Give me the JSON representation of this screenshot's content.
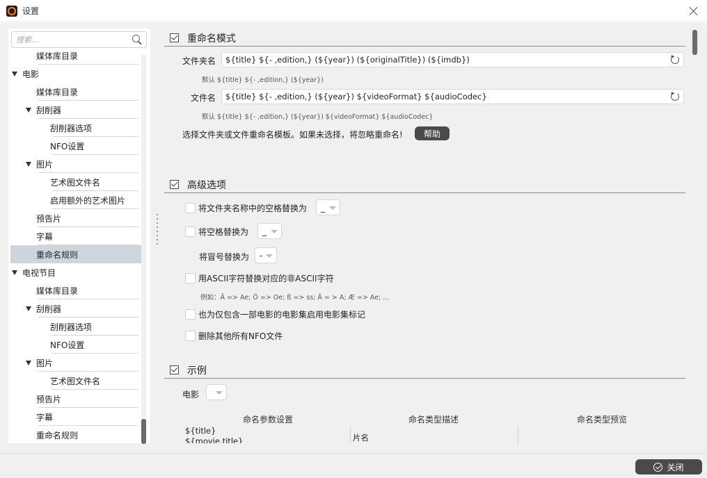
{
  "window": {
    "title": "设置"
  },
  "sidebar": {
    "search_placeholder": "搜索...",
    "items": [
      {
        "label": "媒体库目录",
        "level": 1,
        "expander": false
      },
      {
        "label": "电影",
        "level": 0,
        "expander": true
      },
      {
        "label": "媒体库目录",
        "level": 1,
        "expander": false
      },
      {
        "label": "刮削器",
        "level": 1,
        "expander": true
      },
      {
        "label": "刮削器选项",
        "level": 2,
        "expander": false
      },
      {
        "label": "NFO设置",
        "level": 2,
        "expander": false
      },
      {
        "label": "图片",
        "level": 1,
        "expander": true
      },
      {
        "label": "艺术图文件名",
        "level": 2,
        "expander": false
      },
      {
        "label": "启用额外的艺术图片",
        "level": 2,
        "expander": false
      },
      {
        "label": "预告片",
        "level": 1,
        "expander": false
      },
      {
        "label": "字幕",
        "level": 1,
        "expander": false
      },
      {
        "label": "重命名规则",
        "level": 1,
        "expander": false,
        "selected": true
      },
      {
        "label": "电视节目",
        "level": 0,
        "expander": true
      },
      {
        "label": "媒体库目录",
        "level": 1,
        "expander": false
      },
      {
        "label": "刮削器",
        "level": 1,
        "expander": true
      },
      {
        "label": "刮削器选项",
        "level": 2,
        "expander": false
      },
      {
        "label": "NFO设置",
        "level": 2,
        "expander": false
      },
      {
        "label": "图片",
        "level": 1,
        "expander": true
      },
      {
        "label": "艺术图文件名",
        "level": 2,
        "expander": false
      },
      {
        "label": "预告片",
        "level": 1,
        "expander": false
      },
      {
        "label": "字幕",
        "level": 1,
        "expander": false
      },
      {
        "label": "重命名规则",
        "level": 1,
        "expander": false
      }
    ]
  },
  "rename_pattern": {
    "title": "重命名模式",
    "folder_label": "文件夹名",
    "folder_value": "${title} ${- ,edition,} (${year}) (${originalTitle}) (${imdb})",
    "folder_default": "默认  ${title} ${- ,edition,} (${year})",
    "file_label": "文件名",
    "file_value": "${title} ${- ,edition,} (${year}) ${videoFormat} ${audioCodec}",
    "file_default": "默认  ${title} ${- ,edition,} (${year}) ${videoFormat} ${audioCodec}",
    "notice": "选择文件夹或文件重命名模板。如果未选择，将忽略重命名!",
    "help_label": "帮助"
  },
  "advanced": {
    "title": "高级选项",
    "opt_folder_space": "将文件夹名称中的空格替换为",
    "opt_folder_space_value": "_",
    "opt_space": "将空格替换为",
    "opt_space_value": "_",
    "colon_label": "将冒号替换为",
    "colon_value": "-",
    "opt_ascii": "用ASCII字符替换对应的非ASCII字符",
    "ascii_example": "例如：Ä => Ae; Ö => Oe; ß => ss; Â = > A; Æ => Ae; ...",
    "opt_movieset": "也为仅包含一部电影的电影集启用电影集标记",
    "opt_delete_nfo": "删除其他所有NFO文件"
  },
  "example": {
    "title": "示例",
    "movie_label": "电影",
    "columns": [
      "命名参数设置",
      "命名类型描述",
      "命名类型预览"
    ],
    "row_param": "${title}",
    "row_param2": "${movie.title}",
    "row_desc": "片名"
  },
  "footer": {
    "close_label": "关闭"
  }
}
